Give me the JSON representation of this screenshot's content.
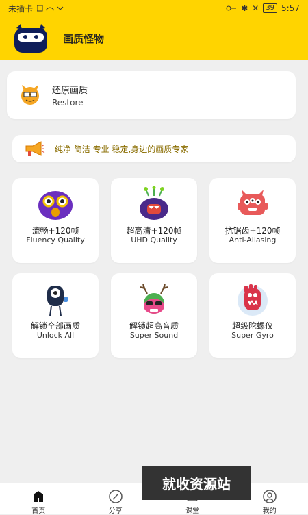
{
  "status_bar": {
    "left": "未插卡",
    "battery": "39",
    "time": "5:57"
  },
  "app": {
    "title": "画质怪物"
  },
  "restore": {
    "title": "还原画质",
    "subtitle": "Restore"
  },
  "slogan": {
    "text": "纯净 简洁 专业 稳定,身边的画质专家"
  },
  "features": [
    {
      "title": "流畅+120帧",
      "subtitle": "Fluency Quality",
      "icon": "purple-monster-icon"
    },
    {
      "title": "超高清+120帧",
      "subtitle": "UHD Quality",
      "icon": "antenna-monster-icon"
    },
    {
      "title": "抗锯齿+120帧",
      "subtitle": "Anti-Aliasing",
      "icon": "red-monster-icon"
    },
    {
      "title": "解锁全部画质",
      "subtitle": "Unlock All",
      "icon": "one-eyed-monster-icon"
    },
    {
      "title": "解锁超高音质",
      "subtitle": "Super Sound",
      "icon": "antler-monster-icon"
    },
    {
      "title": "超级陀螺仪",
      "subtitle": "Super Gyro",
      "icon": "hand-monster-icon"
    }
  ],
  "watermark": "就收资源站",
  "nav": [
    {
      "label": "首页",
      "icon": "home-icon"
    },
    {
      "label": "分享",
      "icon": "compass-icon"
    },
    {
      "label": "课堂",
      "icon": "classroom-icon"
    },
    {
      "label": "我的",
      "icon": "profile-icon"
    }
  ]
}
